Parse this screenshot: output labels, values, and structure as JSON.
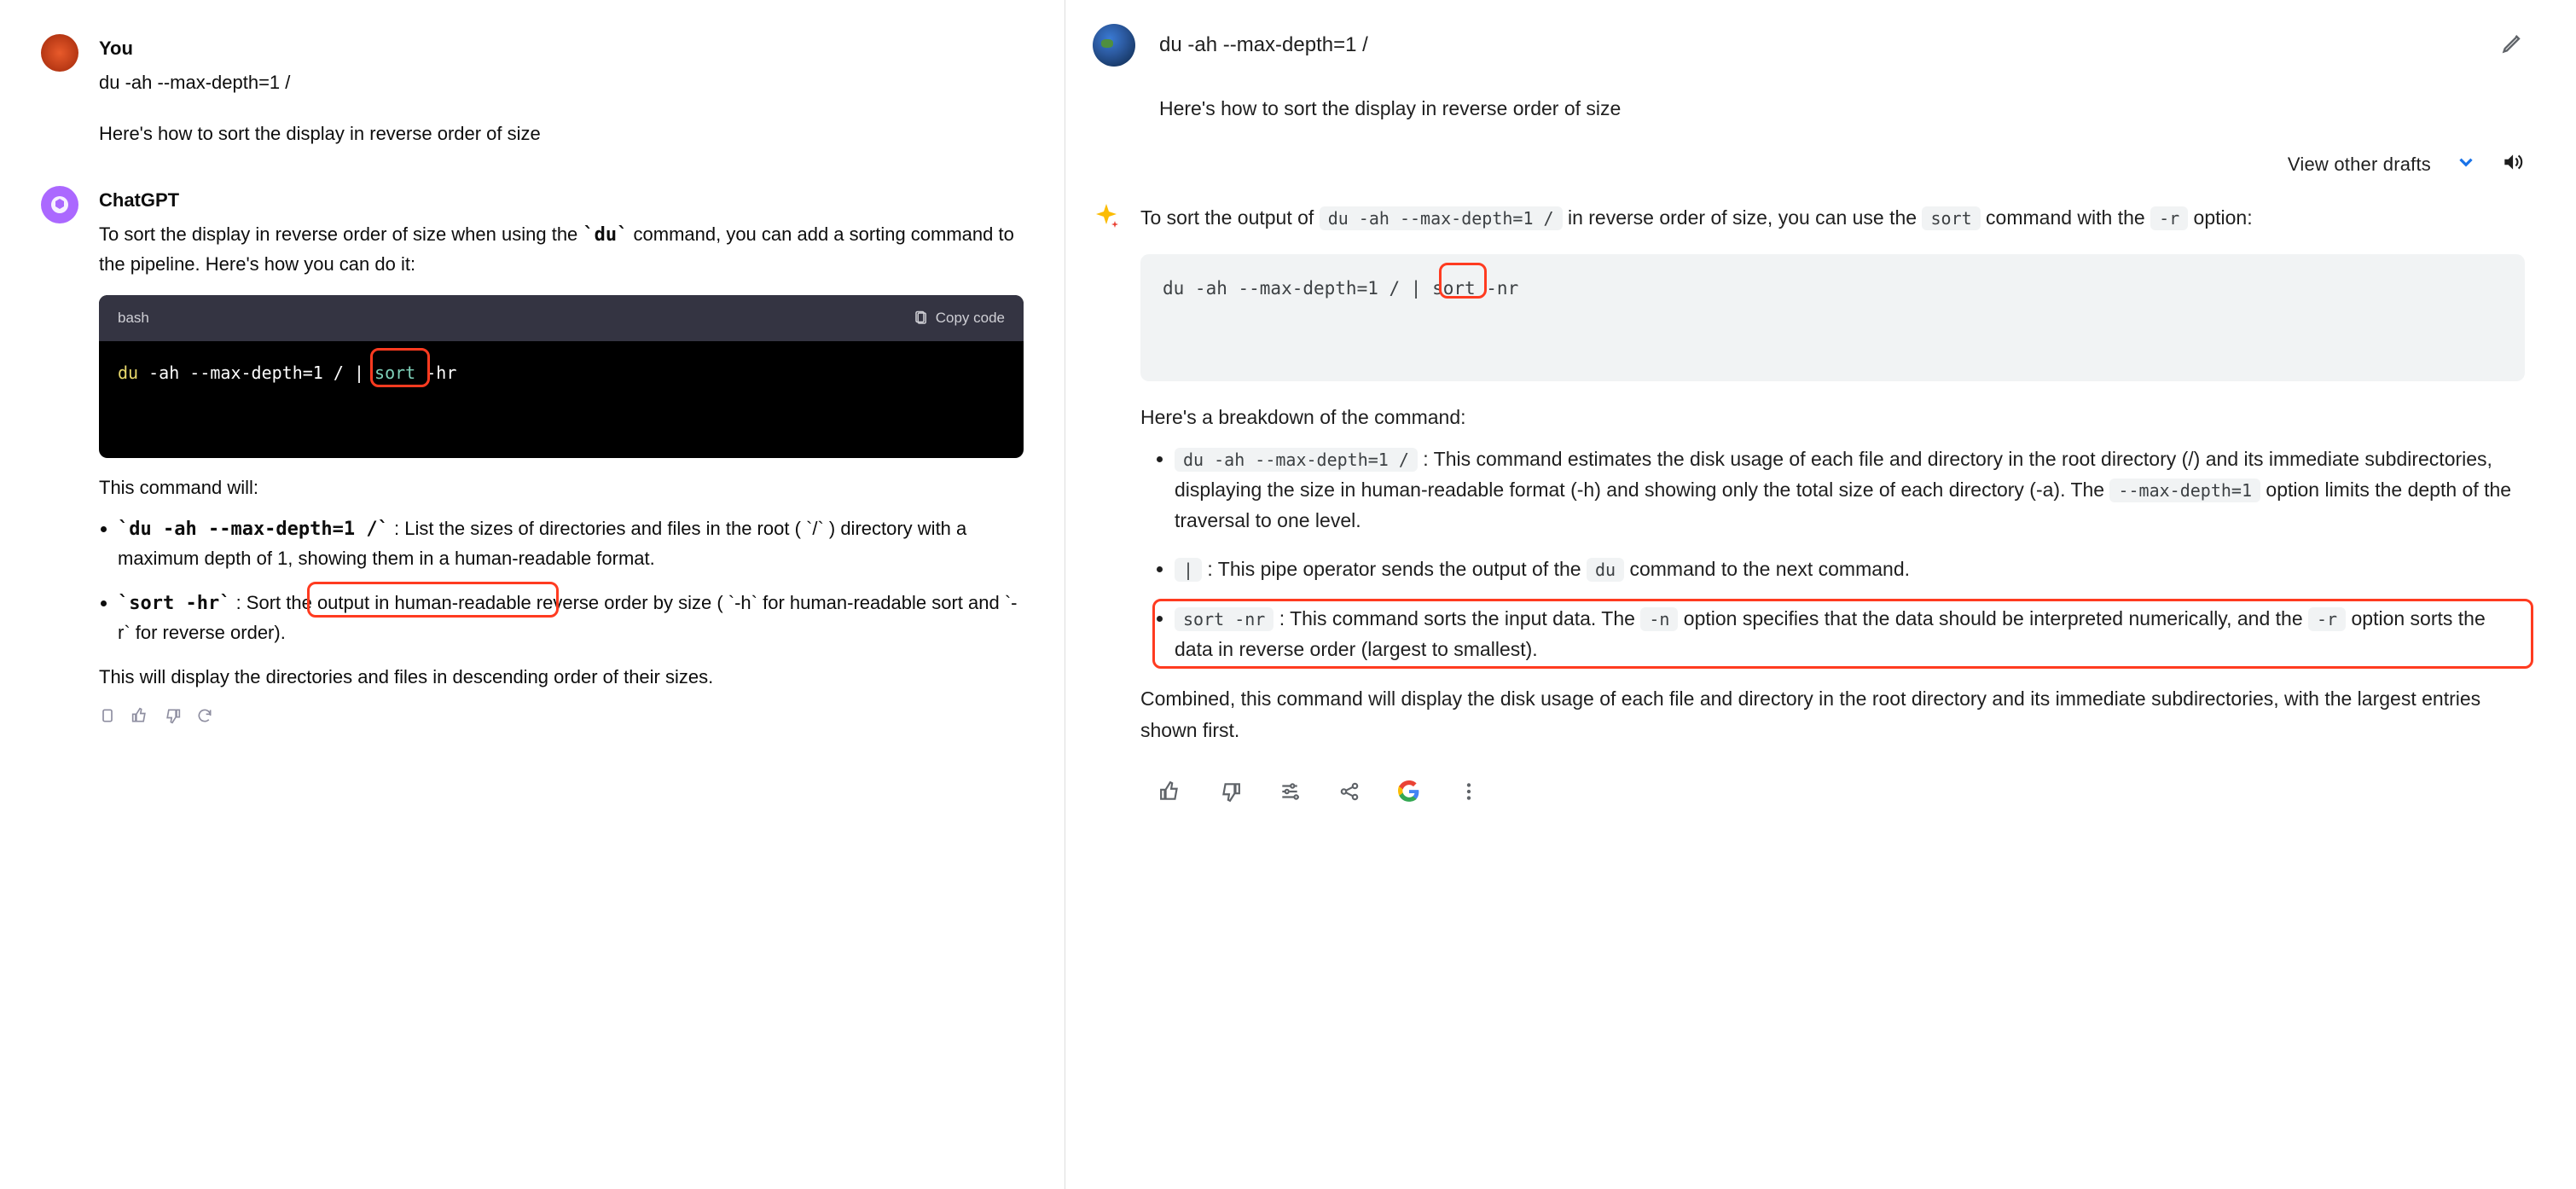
{
  "left": {
    "user": {
      "name": "You",
      "line1": "du -ah --max-depth=1 /",
      "line2": "Here's how to sort the display in reverse order of size"
    },
    "assistant": {
      "name": "ChatGPT",
      "intro": "To sort the display in reverse order of size when using the `du` command, you can add a sorting command to the pipeline. Here's how you can do it:",
      "code": {
        "lang": "bash",
        "copy_label": "Copy code",
        "tok_du": "du",
        "rest1": " -ah --max-depth=1 / | ",
        "tok_sort": "sort",
        "rest2": " -hr",
        "highlight_text": "-hr"
      },
      "after_code": "This command will:",
      "bullet1_code": "`du -ah --max-depth=1 /`",
      "bullet1_rest": " : List the sizes of directories and files in the root ( `/` ) directory with a maximum depth of 1, showing them in a human-readable format.",
      "bullet2_code": "`sort -hr`",
      "bullet2_rest_a": " : Sort the output in ",
      "bullet2_highlight": "human-readable reverse order by size",
      "bullet2_rest_b": " ( `-h` for human-readable sort and `-r` for reverse order).",
      "closing": "This will display the directories and files in descending order of their sizes."
    }
  },
  "right": {
    "user_line": "du -ah --max-depth=1 /",
    "user_follow": "Here's how to sort the display in reverse order of size",
    "view_drafts": "View other drafts",
    "body_part1": "To sort the output of ",
    "body_code1": "du -ah --max-depth=1 /",
    "body_part2": " in reverse order of size, you can use the ",
    "body_code2": "sort",
    "body_part3": " command with the ",
    "body_code3": "-r",
    "body_part4": " option:",
    "code_block": "du -ah --max-depth=1 / | sort -nr",
    "code_highlight": "-nr",
    "breakdown_header": "Here's a breakdown of the command:",
    "bullets": [
      {
        "code": "du -ah --max-depth=1 /",
        "text_a": " : This command estimates the disk usage of each file and directory in the root directory (/) and its immediate subdirectories, displaying the size in human-readable format (-h) and showing only the total size of each directory (-a). The ",
        "code2": "--max-depth=1",
        "text_b": " option limits the depth of the traversal to one level."
      },
      {
        "code": "|",
        "text_a": " : This pipe operator sends the output of the ",
        "code2": "du",
        "text_b": " command to the next command."
      },
      {
        "code": "sort -nr",
        "text_a": " : This command sorts the input data. The ",
        "code2": "-n",
        "text_b": " option specifies that the data should be interpreted numerically, and the ",
        "code3": "-r",
        "text_c": " option sorts the data in reverse order (largest to smallest)."
      }
    ],
    "closing": "Combined, this command will display the disk usage of each file and directory in the root directory and its immediate subdirectories, with the largest entries shown first."
  }
}
